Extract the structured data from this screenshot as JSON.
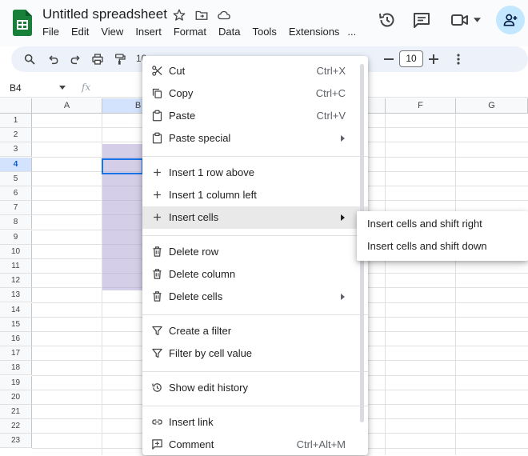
{
  "app": {
    "title": "Untitled spreadsheet",
    "menus": [
      "File",
      "Edit",
      "View",
      "Insert",
      "Format",
      "Data",
      "Tools",
      "Extensions",
      "..."
    ]
  },
  "toolbar": {
    "zoom_fragment": "10",
    "font_size": "10"
  },
  "formula_bar": {
    "name_box": "B4",
    "fx_label": "fx"
  },
  "grid": {
    "columns": [
      "A",
      "B",
      "",
      "",
      "",
      "F",
      "G"
    ],
    "rows": [
      "1",
      "2",
      "3",
      "4",
      "5",
      "6",
      "7",
      "8",
      "9",
      "10",
      "11",
      "12",
      "13",
      "14",
      "15",
      "16",
      "17",
      "18",
      "19",
      "20",
      "21",
      "22",
      "23"
    ],
    "active_cell": "B4",
    "selected_column": "B",
    "selected_row": "4"
  },
  "context_menu": {
    "items": [
      {
        "icon": "scissors-icon",
        "label": "Cut",
        "shortcut": "Ctrl+X"
      },
      {
        "icon": "copy-icon",
        "label": "Copy",
        "shortcut": "Ctrl+C"
      },
      {
        "icon": "clipboard-icon",
        "label": "Paste",
        "shortcut": "Ctrl+V"
      },
      {
        "icon": "clipboard-icon",
        "label": "Paste special",
        "shortcut": ""
      },
      {
        "icon": "plus-icon",
        "label": "Insert 1 row above",
        "shortcut": ""
      },
      {
        "icon": "plus-icon",
        "label": "Insert 1 column left",
        "shortcut": ""
      },
      {
        "icon": "plus-icon",
        "label": "Insert cells",
        "shortcut": ""
      },
      {
        "icon": "trash-icon",
        "label": "Delete row",
        "shortcut": ""
      },
      {
        "icon": "trash-icon",
        "label": "Delete column",
        "shortcut": ""
      },
      {
        "icon": "trash-icon",
        "label": "Delete cells",
        "shortcut": ""
      },
      {
        "icon": "filter-icon",
        "label": "Create a filter",
        "shortcut": ""
      },
      {
        "icon": "filter-icon",
        "label": "Filter by cell value",
        "shortcut": ""
      },
      {
        "icon": "history-icon",
        "label": "Show edit history",
        "shortcut": ""
      },
      {
        "icon": "link-icon",
        "label": "Insert link",
        "shortcut": ""
      },
      {
        "icon": "comment-icon",
        "label": "Comment",
        "shortcut": "Ctrl+Alt+M"
      }
    ],
    "highlighted": "Insert cells"
  },
  "submenu": {
    "items": [
      "Insert cells and shift right",
      "Insert cells and shift down"
    ]
  },
  "colors": {
    "accent": "#1a73e8",
    "selection": "#b3a5d6",
    "header_selected": "#d3e3fd",
    "share_button": "#c2e7ff"
  }
}
